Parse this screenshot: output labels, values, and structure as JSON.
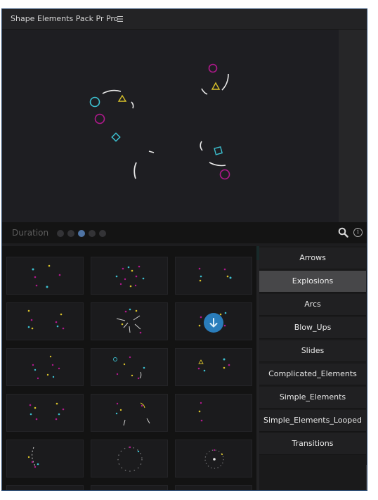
{
  "panel": {
    "title": "Shape Elements Pack Pr Pro",
    "menu_glyph": "☰"
  },
  "duration": {
    "label": "Duration",
    "steps": 5,
    "selected": 3
  },
  "icons": [
    "menu-icon",
    "search-icon",
    "info-icon",
    "download-arrow-icon"
  ],
  "categories": [
    {
      "label": "Arrows"
    },
    {
      "label": "Explosions"
    },
    {
      "label": "Arcs"
    },
    {
      "label": "Blow_Ups"
    },
    {
      "label": "Slides"
    },
    {
      "label": "Complicated_Elements"
    },
    {
      "label": "Simple_Elements"
    },
    {
      "label": "Simple_Elements_Looped"
    },
    {
      "label": "Transitions"
    }
  ],
  "selected_category": "Explosions",
  "colors": {
    "accent": "#2a7dbb",
    "magenta": "#b0198c",
    "cyan": "#3cc0d0",
    "yellow": "#d8c12a",
    "white": "#e8e8e8",
    "active_dot": "#4f74a4"
  }
}
